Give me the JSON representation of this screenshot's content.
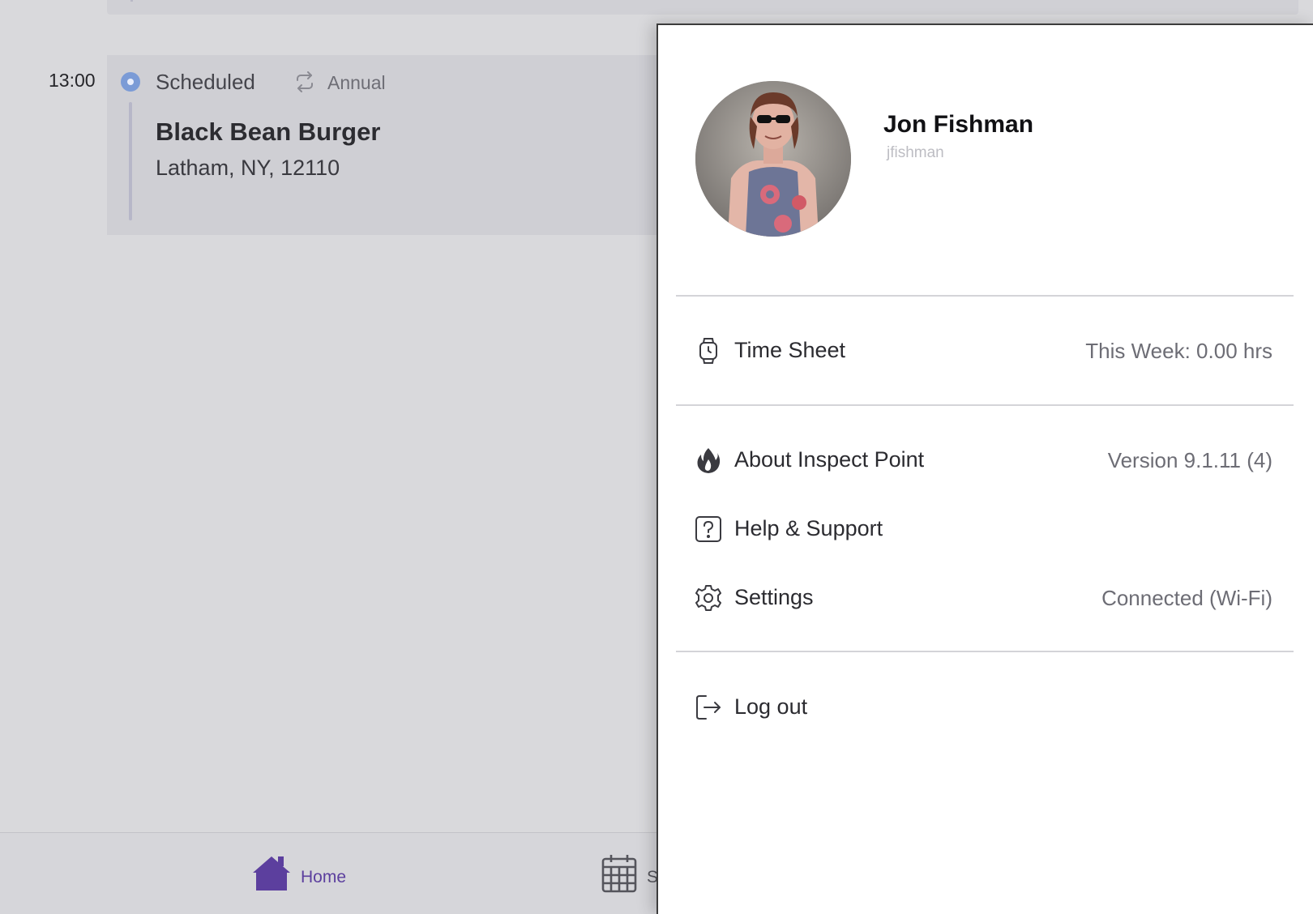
{
  "schedule": {
    "time": "13:00",
    "status": "Scheduled",
    "recurrence": "Annual",
    "title": "Black Bean Burger",
    "address": "Latham, NY, 12110",
    "status_color": "#7b9bd6"
  },
  "bottom_nav": {
    "home_label": "Home",
    "schedule_label_partial": "S",
    "active_color": "#5c3f9e"
  },
  "profile": {
    "name": "Jon Fishman",
    "username": "jfishman"
  },
  "menu": {
    "time_sheet": {
      "label": "Time Sheet",
      "value": "This Week: 0.00 hrs",
      "icon": "watch-icon"
    },
    "about": {
      "label": "About Inspect Point",
      "value": "Version 9.1.11 (4)",
      "icon": "flame-icon"
    },
    "help": {
      "label": "Help & Support",
      "icon": "question-icon"
    },
    "settings": {
      "label": "Settings",
      "value": "Connected (Wi-Fi)",
      "icon": "gear-icon"
    },
    "logout": {
      "label": "Log out",
      "icon": "logout-icon"
    }
  }
}
